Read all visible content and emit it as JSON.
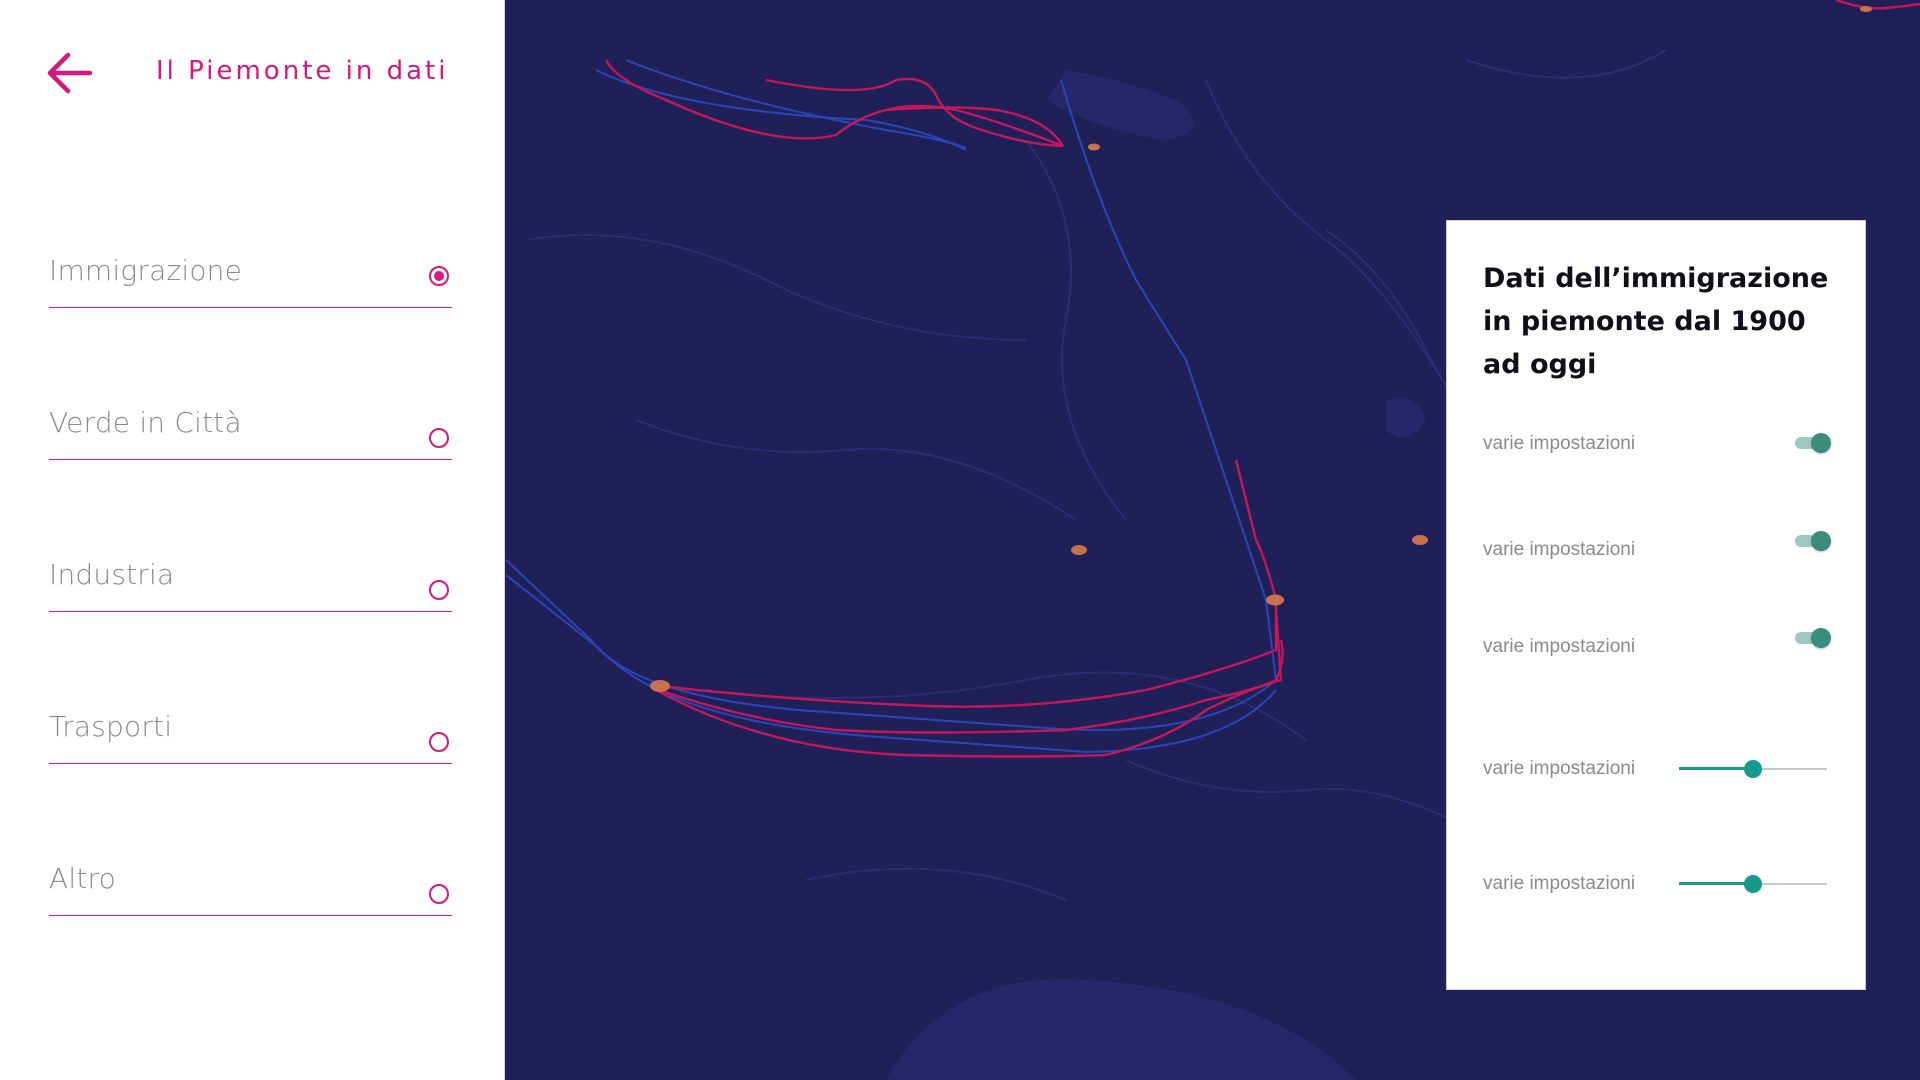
{
  "sidebar": {
    "title": "Il Piemonte in dati",
    "back_icon": "arrow-left-icon",
    "items": [
      {
        "label": "Immigrazione",
        "selected": true
      },
      {
        "label": "Verde in Città",
        "selected": false
      },
      {
        "label": "Industria",
        "selected": false
      },
      {
        "label": "Trasporti",
        "selected": false
      },
      {
        "label": "Altro",
        "selected": false
      }
    ]
  },
  "panel": {
    "title": "Dati dell’immigrazione in piemonte dal 1900 ad oggi",
    "toggles": [
      {
        "label": "varie impostazioni",
        "on": true
      },
      {
        "label": "varie impostazioni",
        "on": true
      },
      {
        "label": "varie impostazioni",
        "on": true
      }
    ],
    "sliders": [
      {
        "label": "varie impostazioni",
        "value": 0.5
      },
      {
        "label": "varie impostazioni",
        "value": 0.5
      }
    ]
  },
  "colors": {
    "accent": "#d6177e",
    "map_background": "#1f2057",
    "route_magenta": "#c2185b",
    "route_blue": "#2c4cc8",
    "city_marker": "#c9704f",
    "toggle": "#3a8c7c",
    "slider": "#14998a"
  }
}
